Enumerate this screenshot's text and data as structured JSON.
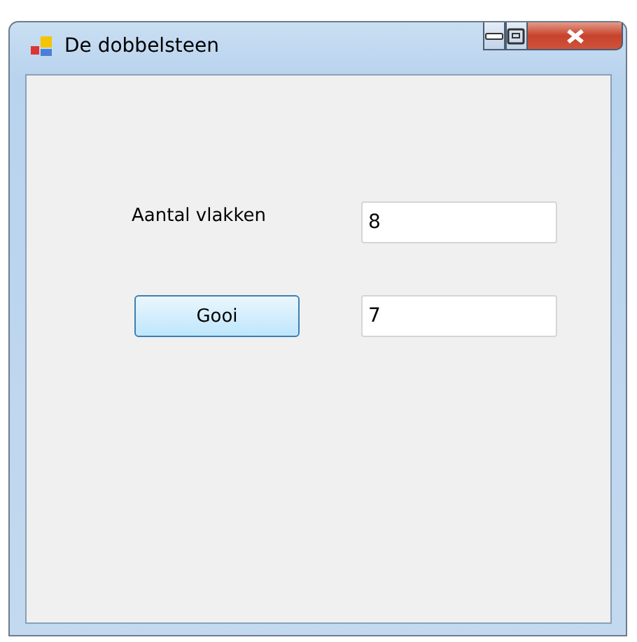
{
  "window": {
    "title": "De dobbelsteen",
    "caption_buttons": [
      {
        "kind": "minimize"
      },
      {
        "kind": "maximize"
      },
      {
        "kind": "close"
      }
    ]
  },
  "form": {
    "label": "Aantal vlakken",
    "faces_field": {
      "value": "8"
    },
    "roll_button": {
      "label": "Gooi"
    },
    "result_field": {
      "value": "7"
    }
  }
}
